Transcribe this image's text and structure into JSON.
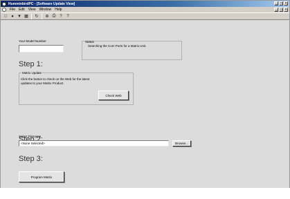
{
  "window": {
    "title": "HumminbirdPC - [Software Update View]"
  },
  "menu": {
    "items": [
      "File",
      "Edit",
      "View",
      "Window",
      "Help"
    ]
  },
  "title_buttons": [
    "_",
    "□",
    "×"
  ],
  "toolbar": {
    "icons": [
      "new-icon",
      "record-icon",
      "save-icon",
      "grid-icon",
      "refresh-icon",
      "zoom-icon",
      "print-icon",
      "help-icon",
      "whats-this-icon"
    ],
    "glyphs": [
      "□",
      "●",
      "▼",
      "▦",
      "↻",
      "⊕",
      "⎙",
      "?",
      "?"
    ]
  },
  "model": {
    "label": "Your Model Number",
    "value": ""
  },
  "status": {
    "label": "Status",
    "text": "Searching the Com Ports for a Matrix Unit."
  },
  "step1": {
    "heading": "Step 1:",
    "group_title": "Matrix Update",
    "description_line1": "Click the button to check on the Web for the latest",
    "description_line2": "updates to your Matrix Product.",
    "button": "Check Web"
  },
  "step2": {
    "heading": "Step 2:",
    "filename_label": "Select Filename",
    "filename_value": "<None Selected>",
    "browse_button": "Browse..."
  },
  "step3": {
    "heading": "Step 3:",
    "program_button": "Program Matrix"
  }
}
